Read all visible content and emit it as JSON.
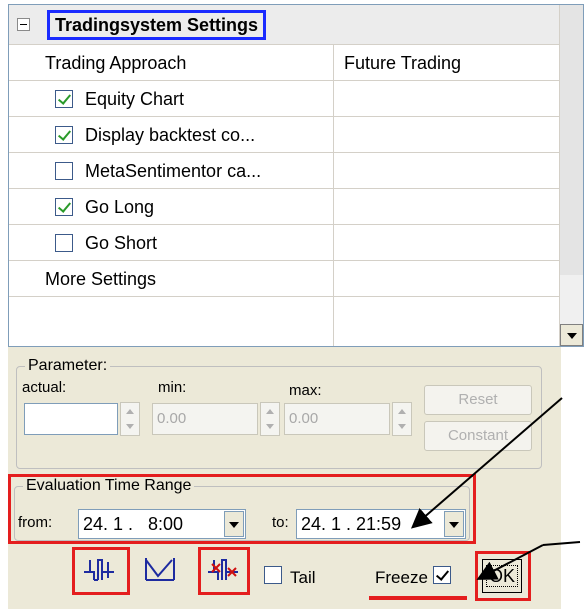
{
  "settings_grid": {
    "category_title": "Tradingsystem Settings",
    "rows": [
      {
        "label": "Trading Approach",
        "value": "Future Trading",
        "checkbox": null
      },
      {
        "label": "Equity Chart",
        "value": "",
        "checkbox": true
      },
      {
        "label": "Display backtest co...",
        "value": "",
        "checkbox": true
      },
      {
        "label": "MetaSentimentor ca...",
        "value": "",
        "checkbox": false
      },
      {
        "label": "Go Long",
        "value": "",
        "checkbox": true
      },
      {
        "label": "Go Short",
        "value": "",
        "checkbox": false
      },
      {
        "label": "More Settings",
        "value": "",
        "checkbox": null
      }
    ]
  },
  "parameter": {
    "group_label": "Parameter:",
    "actual_label": "actual:",
    "min_label": "min:",
    "max_label": "max:",
    "actual_value": "",
    "min_value": "0.00",
    "max_value": "0.00",
    "reset_label": "Reset",
    "constant_label": "Constant"
  },
  "time_range": {
    "group_label": "Evaluation Time Range",
    "from_label": "from:",
    "from_value": "24. 1 .   8:00",
    "to_label": "to:",
    "to_value": "24. 1 . 21:59"
  },
  "bottom_bar": {
    "tail_label": "Tail",
    "tail_checked": false,
    "freeze_label": "Freeze",
    "freeze_checked": true,
    "ok_label": "OK"
  },
  "colors": {
    "highlight_red": "#e41e1e",
    "category_blue": "#1a2bff",
    "panel_bg": "#ece9d8",
    "check_green": "#2a9a2a"
  }
}
